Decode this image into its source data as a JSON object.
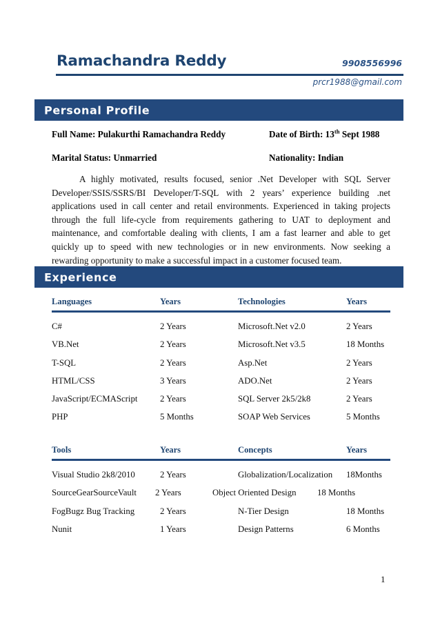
{
  "document": {
    "page_number": "1"
  },
  "header": {
    "name": "Ramachandra Reddy",
    "phone": "9908556996",
    "email": "prcr1988@gmail.com"
  },
  "colors": {
    "bar_navy": "#23497d",
    "heading_navy": "#1f4571",
    "accent_blue": "#2b5285",
    "page_background": "#ffffff"
  },
  "sections": {
    "personal_profile": {
      "title": "Personal Profile",
      "details": [
        {
          "label": "Full Name: Pulakurthi Ramachandra Reddy"
        },
        {
          "label": "Date of Birth: 13",
          "superscript": "th",
          "suffix": " Sept 1988"
        },
        {
          "label": "Marital Status: Unmarried"
        },
        {
          "label": "Nationality: Indian"
        }
      ],
      "summary": "A highly motivated, results focused, senior .Net Developer with SQL Server Developer/SSIS/SSRS/BI Developer/T-SQL with 2 years’ experience building .net applications used in call center and retail environments. Experienced in taking projects through the full life-cycle from requirements gathering to UAT to deployment and maintenance, and comfortable dealing with clients, I am a fast learner and able to get quickly up to speed with new technologies or in new environments. Now seeking a rewarding opportunity to make a successful impact in a customer focused team."
    },
    "experience": {
      "title": "Experience",
      "languages_table": {
        "headers": [
          "Languages",
          "Years",
          "Technologies",
          "Years"
        ],
        "rows": [
          [
            "C#",
            "2 Years",
            "Microsoft.Net v2.0",
            "2 Years"
          ],
          [
            "VB.Net",
            "2 Years",
            "Microsoft.Net v3.5",
            "18 Months"
          ],
          [
            "T-SQL",
            "2 Years",
            "Asp.Net",
            "2 Years"
          ],
          [
            "HTML/CSS",
            "3 Years",
            "ADO.Net",
            "2 Years"
          ],
          [
            "JavaScript/ECMAScript",
            "2 Years",
            "SQL Server 2k5/2k8",
            "2 Years"
          ],
          [
            "PHP",
            "5 Months",
            "SOAP Web Services",
            "5 Months"
          ]
        ]
      },
      "tools_table": {
        "headers": [
          "Tools",
          "Years",
          "Concepts",
          "Years"
        ],
        "rows": [
          [
            "Visual Studio 2k8/2010",
            "2 Years",
            "Globalization/Localization",
            "18Months"
          ],
          [
            "SourceGearSourceVault",
            "2 Years",
            "Object Oriented Design",
            "18 Months"
          ],
          [
            "FogBugz Bug Tracking",
            "2 Years",
            "N-Tier Design",
            "18 Months"
          ],
          [
            "Nunit",
            "1 Years",
            "Design Patterns",
            "6 Months"
          ]
        ]
      }
    }
  }
}
